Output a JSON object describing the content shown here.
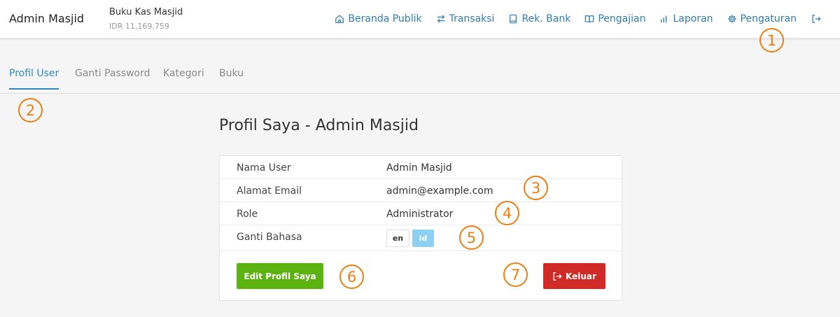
{
  "header": {
    "brand": "Admin Masjid",
    "book_title": "Buku Kas Masjid",
    "book_balance": "IDR 11,169,759",
    "nav": [
      {
        "label": "Beranda Publik",
        "icon": "home-icon"
      },
      {
        "label": "Transaksi",
        "icon": "exchange-icon"
      },
      {
        "label": "Rek. Bank",
        "icon": "book-icon"
      },
      {
        "label": "Pengajian",
        "icon": "open-book-icon"
      },
      {
        "label": "Laporan",
        "icon": "bar-chart-icon"
      },
      {
        "label": "Pengaturan",
        "icon": "gear-icon"
      }
    ],
    "logout_icon": "logout-icon"
  },
  "tabs": [
    {
      "label": "Profil User",
      "active": true
    },
    {
      "label": "Ganti Password",
      "active": false
    },
    {
      "label": "Kategori",
      "active": false
    },
    {
      "label": "Buku",
      "active": false
    }
  ],
  "main": {
    "title": "Profil Saya - Admin Masjid",
    "rows": [
      {
        "label": "Nama User",
        "value": "Admin Masjid"
      },
      {
        "label": "Alamat Email",
        "value": "admin@example.com"
      },
      {
        "label": "Role",
        "value": "Administrator"
      },
      {
        "label": "Ganti Bahasa",
        "value": ""
      }
    ],
    "languages": [
      {
        "code": "en",
        "selected": false
      },
      {
        "code": "id",
        "selected": true
      }
    ],
    "edit_button": "Edit Profil Saya",
    "logout_button": "Keluar"
  },
  "callouts": [
    "1",
    "2",
    "3",
    "4",
    "5",
    "6",
    "7"
  ],
  "colors": {
    "link": "#2e7bad",
    "active_tab": "#2e8bc0",
    "edit_button": "#5cb30f",
    "logout_button": "#d12b27",
    "lang_selected": "#8dd0f3",
    "callout": "#ea7e10"
  }
}
